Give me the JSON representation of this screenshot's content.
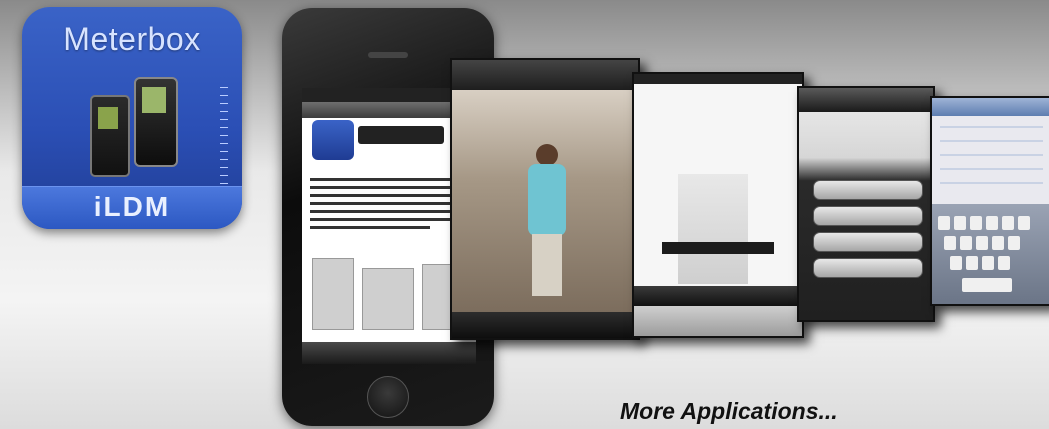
{
  "app_icon": {
    "title": "Meterbox",
    "label": "iLDM",
    "accent_color": "#2b4fb5"
  },
  "screenshots": {
    "keypad_buttons": [
      "",
      "",
      "",
      ""
    ]
  },
  "caption": "More Applications..."
}
